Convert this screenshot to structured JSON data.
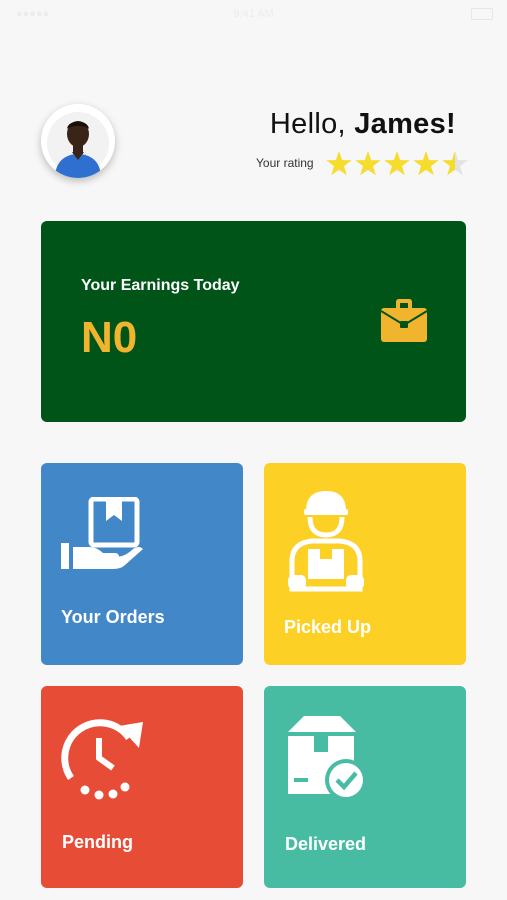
{
  "status_bar": {
    "left": "●●●●●",
    "center": "9:41 AM"
  },
  "header": {
    "greeting_prefix": "Hello, ",
    "user_name": "James!",
    "rating_label": "Your rating",
    "rating_value": 4.5,
    "rating_max": 5,
    "star_color": "#f5dc2d"
  },
  "earnings": {
    "title": "Your Earnings Today",
    "value": "N0",
    "icon": "briefcase-icon",
    "bg_color": "#005417",
    "accent_color": "#f1b42f"
  },
  "tiles": [
    {
      "label": "Your Orders",
      "icon": "box-in-hand-icon",
      "color": "#4287c7"
    },
    {
      "label": "Picked Up",
      "icon": "delivery-person-icon",
      "color": "#fdd026"
    },
    {
      "label": "Pending",
      "icon": "clock-refresh-icon",
      "color": "#e74c36"
    },
    {
      "label": "Delivered",
      "icon": "package-check-icon",
      "color": "#48bca3"
    }
  ]
}
